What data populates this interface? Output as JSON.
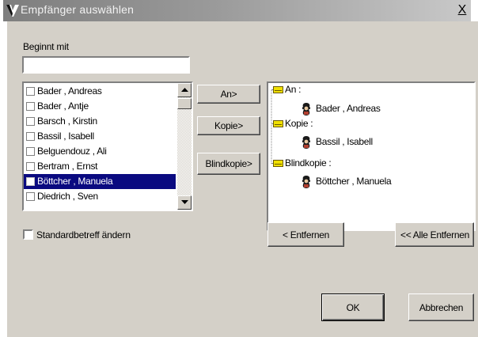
{
  "window": {
    "title": "Empfänger auswählen",
    "close_label": "X"
  },
  "search": {
    "label": "Beginnt mit",
    "value": "",
    "placeholder": ""
  },
  "list": {
    "items": [
      {
        "name": "Bader , Andreas",
        "checked": false,
        "selected": false
      },
      {
        "name": "Bader , Antje",
        "checked": false,
        "selected": false
      },
      {
        "name": "Barsch , Kirstin",
        "checked": false,
        "selected": false
      },
      {
        "name": "Bassil , Isabell",
        "checked": false,
        "selected": false
      },
      {
        "name": "Belguendouz , Ali",
        "checked": false,
        "selected": false
      },
      {
        "name": "Bertram , Ernst",
        "checked": false,
        "selected": false
      },
      {
        "name": "Böttcher , Manuela",
        "checked": false,
        "selected": true
      },
      {
        "name": "Diedrich , Sven",
        "checked": false,
        "selected": false
      }
    ]
  },
  "buttons": {
    "an": "An>",
    "kopie": "Kopie>",
    "blindkopie": "Blindkopie>",
    "entfernen": "< Entfernen",
    "alle_entfernen": "<< Alle Entfernen",
    "ok": "OK",
    "abbrechen": "Abbrechen"
  },
  "recipients": {
    "an_label": "An :",
    "an_entry": "Bader , Andreas",
    "kopie_label": "Kopie :",
    "kopie_entry": "Bassil , Isabell",
    "blindkopie_label": "Blindkopie :",
    "blindkopie_entry": "Böttcher , Manuela"
  },
  "options": {
    "standardbetreff_label": "Standardbetreff ändern",
    "standardbetreff_checked": false
  },
  "colors": {
    "selection": "#0a0a80",
    "dialog_face": "#d4d0c8",
    "envelope": "#f0e000"
  },
  "icons": {
    "title": "app-logo-icon",
    "folder": "envelope-icon",
    "person": "person-icon"
  }
}
